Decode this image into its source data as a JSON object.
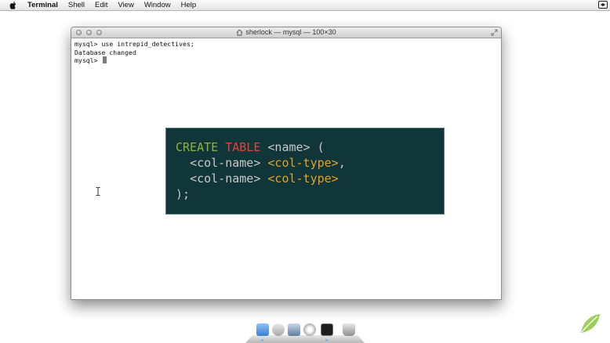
{
  "menubar": {
    "app_name": "Terminal",
    "items": [
      "Shell",
      "Edit",
      "View",
      "Window",
      "Help"
    ]
  },
  "window": {
    "title": "sherlock — mysql — 100×30",
    "lines": [
      "mysql> use intrepid_detectives;",
      "Database changed"
    ],
    "prompt": "mysql> "
  },
  "card": {
    "line1": {
      "kw1": "CREATE",
      "kw2": "TABLE",
      "rest": " <name> ("
    },
    "line2": {
      "indent": "  ",
      "name": "<col-name> ",
      "type": "<col-type>",
      "tail": ","
    },
    "line3": {
      "indent": "  ",
      "name": "<col-name> ",
      "type": "<col-type>"
    },
    "line4": ");"
  },
  "dock": {
    "icons": [
      "finder-icon",
      "stamp-icon",
      "preview-icon",
      "safari-icon",
      "terminal-icon",
      "trash-icon"
    ]
  },
  "colors": {
    "card_bg": "#10363a",
    "keyword_green": "#8fb13a",
    "keyword_red": "#e2433a",
    "type_orange": "#e6a222"
  }
}
